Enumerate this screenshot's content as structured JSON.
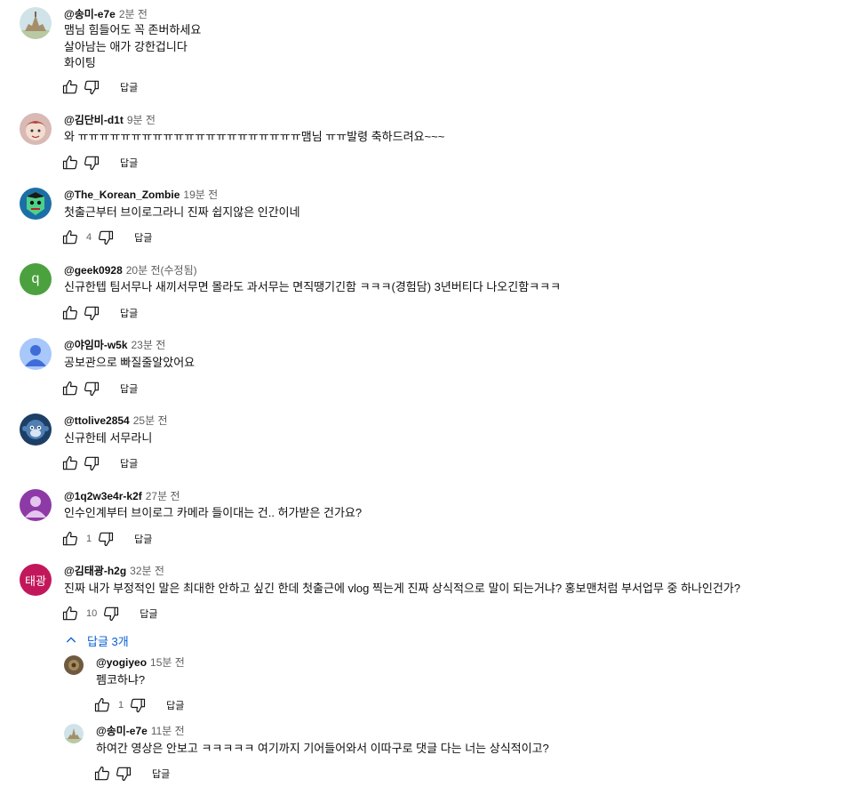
{
  "comments": [
    {
      "author": "@송미-e7e",
      "time": "2분 전",
      "text": "맴님 힘들어도 꼭 존버하세요\n살아남는 애가 강한겁니다\n화이팅",
      "likes": "",
      "avatar": "castle"
    },
    {
      "author": "@김단비-d1t",
      "time": "9분 전",
      "text": "와 ㅠㅠㅠㅠㅠㅠㅠㅠㅠㅠㅠㅠㅠㅠㅠㅠㅠㅠㅠㅠㅠ맴님 ㅠㅠ발령 축하드려요~~~",
      "likes": "",
      "avatar": "character"
    },
    {
      "author": "@The_Korean_Zombie",
      "time": "19분 전",
      "text": "첫출근부터 브이로그라니 진짜 쉽지않은 인간이네",
      "likes": "4",
      "avatar": "zombie"
    },
    {
      "author": "@geek0928",
      "time": "20분 전(수정됨)",
      "text": "신규한텝 팀서무나 새끼서무면 몰라도 과서무는 면직땡기긴함 ㅋㅋㅋ(경험담) 3년버티다 나오긴함ㅋㅋㅋ",
      "likes": "",
      "avatar": "letter-q"
    },
    {
      "author": "@야임마-w5k",
      "time": "23분 전",
      "text": "공보관으로 빠질줄알았어요",
      "likes": "",
      "avatar": "default-blue"
    },
    {
      "author": "@ttolive2854",
      "time": "25분 전",
      "text": "신규한테 서무라니",
      "likes": "",
      "avatar": "monkey"
    },
    {
      "author": "@1q2w3e4r-k2f",
      "time": "27분 전",
      "text": "인수인계부터 브이로그 카메라 들이대는 건.. 허가받은 건가요?",
      "likes": "1",
      "avatar": "default-purple"
    },
    {
      "author": "@김태광-h2g",
      "time": "32분 전",
      "text": "진짜 내가 부정적인 말은 최대한 안하고 싶긴 한데 첫출근에 vlog 찍는게 진짜 상식적으로 말이 되는거냐? 홍보맨처럼 부서업무 중 하나인건가?",
      "likes": "10",
      "avatar": "letter-text",
      "avatar_text": "태광"
    }
  ],
  "replies_toggle": "답글 3개",
  "replies": [
    {
      "author": "@yogiyeo",
      "time": "15분 전",
      "text": "펨코하냐?",
      "likes": "1",
      "avatar": "brown"
    },
    {
      "author": "@송미-e7e",
      "time": "11분 전",
      "text": "하여간 영상은 안보고 ㅋㅋㅋㅋㅋ 여기까지 기어들어와서 이따구로 댓글 다는 너는 상식적이고?",
      "likes": "",
      "avatar": "castle"
    }
  ],
  "reply_label": "답글",
  "icons": {
    "like": "thumbs-up-icon",
    "dislike": "thumbs-down-icon",
    "chevron": "chevron-up-icon"
  },
  "colors": {
    "link": "#065fd4",
    "meta": "#606060",
    "avatar_q": "#4ba13e",
    "avatar_tk": "#c2185b"
  }
}
